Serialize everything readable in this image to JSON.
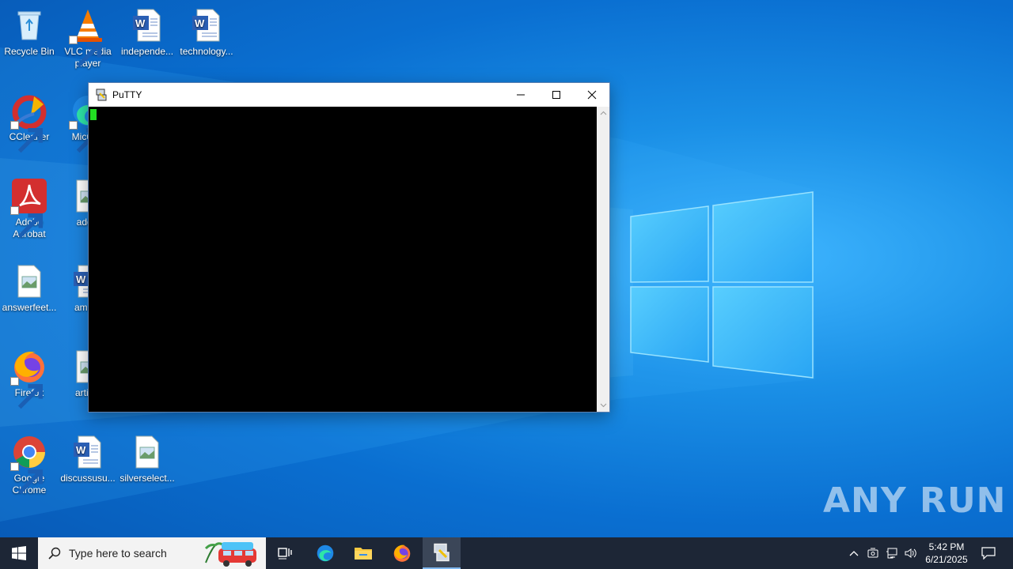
{
  "desktop": {
    "icons": [
      {
        "label": "Recycle Bin"
      },
      {
        "label": "VLC media player"
      },
      {
        "label": "independe..."
      },
      {
        "label": "technology..."
      },
      {
        "label": "CCleaner"
      },
      {
        "label": "Micr Ed"
      },
      {
        "label": "Adobe Acrobat"
      },
      {
        "label": "additi"
      },
      {
        "label": "answerfeet..."
      },
      {
        "label": "amour"
      },
      {
        "label": "Firefox"
      },
      {
        "label": "article"
      },
      {
        "label": "Google Chrome"
      },
      {
        "label": "discussusu..."
      },
      {
        "label": "silverselect..."
      }
    ]
  },
  "putty": {
    "title": "PuTTY",
    "cursor_color": "#22dd22"
  },
  "watermark": "ANY RUN",
  "taskbar": {
    "search_placeholder": "Type here to search",
    "clock_time": "5:42 PM",
    "clock_date": "6/21/2025",
    "apps": [
      "task-view",
      "edge",
      "file-explorer",
      "firefox",
      "putty"
    ]
  },
  "colors": {
    "taskbar_bg": "#1d2636",
    "desktop_blue": "#0a6fd1",
    "accent": "#7fb7ef"
  }
}
